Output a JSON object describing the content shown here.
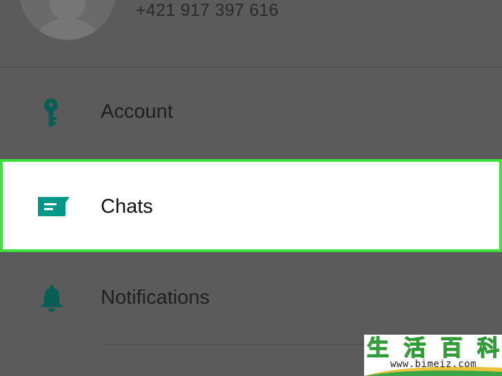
{
  "profile": {
    "phone": "+421 917 397 616",
    "avatar_icon": "default-avatar-icon"
  },
  "settings": {
    "items": [
      {
        "label": "Account",
        "icon": "key-icon",
        "icon_color": "#075e54"
      },
      {
        "label": "Chats",
        "icon": "chat-bubble-icon",
        "icon_color": "#009688",
        "highlighted": true
      },
      {
        "label": "Notifications",
        "icon": "bell-icon",
        "icon_color": "#075e54"
      }
    ]
  },
  "highlight_color": "#3fe23a",
  "watermark": {
    "chars": [
      "生",
      "活",
      "百",
      "科"
    ],
    "url": "www.bimeiz.com"
  }
}
